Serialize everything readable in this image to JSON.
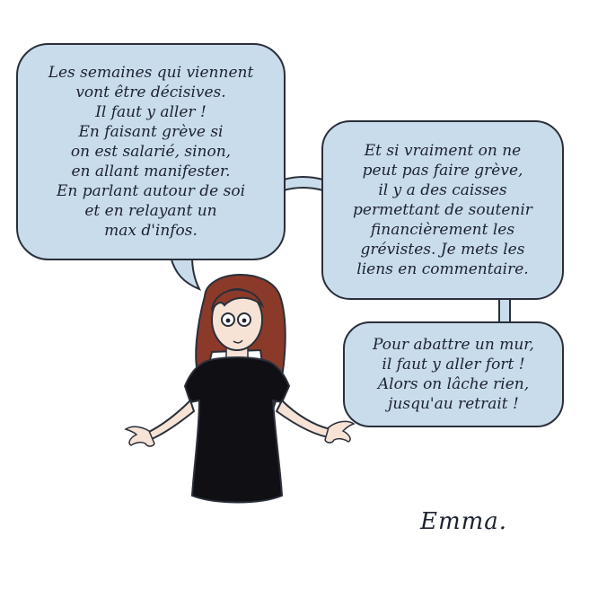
{
  "comic": {
    "bubble_left": {
      "lines": [
        "Les semaines qui viennent",
        "vont être décisives.",
        "Il faut y aller !",
        "En faisant grève si",
        "on est salarié, sinon,",
        "en allant manifester.",
        "En parlant autour de soi",
        "et en relayant un",
        "max d'infos."
      ]
    },
    "bubble_right_top": {
      "lines": [
        "Et si vraiment on ne",
        "peut pas faire grève,",
        "il y a des caisses",
        "permettant de soutenir",
        "financièrement les",
        "grévistes. Je mets les",
        "liens en commentaire."
      ]
    },
    "bubble_right_bottom": {
      "lines": [
        "Pour abattre un mur,",
        "il faut y aller fort !",
        "Alors on lâche rien,",
        "jusqu'au retrait !"
      ]
    },
    "signature": "Emma."
  },
  "colors": {
    "bubble_fill": "#c9dcec",
    "outline": "#2a2f3a",
    "hair": "#8b3a2a",
    "skin": "#f6e3d6",
    "shirt": "#0f0f14"
  }
}
